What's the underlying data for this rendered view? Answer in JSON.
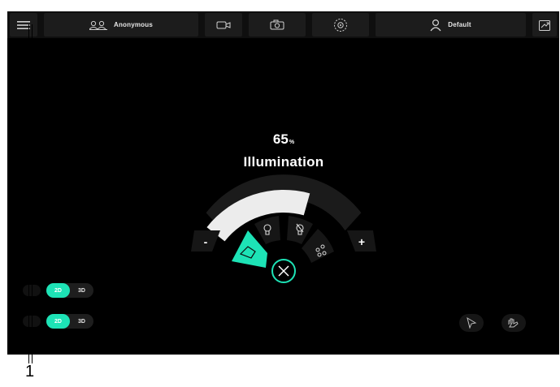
{
  "topbar": {
    "patient_label": "Anonymous",
    "profile_label": "Default",
    "icons": [
      "menu-icon",
      "patient-icon",
      "video-icon",
      "camera-icon",
      "focus-icon",
      "user-icon",
      "export-icon"
    ]
  },
  "illumination": {
    "value": "65",
    "unit": "%",
    "title": "Illumination",
    "level": 0.65,
    "minus_label": "-",
    "plus_label": "+",
    "modes": [
      "light-mode-icon",
      "bulb-icon",
      "bulb-alt-icon",
      "scene-icon"
    ],
    "close_icon": "close-icon"
  },
  "toggles": [
    {
      "on_label": "2D",
      "off_label": "3D"
    },
    {
      "on_label": "2D",
      "off_label": "3D"
    }
  ],
  "corner_buttons": [
    "pointer-icon",
    "hand-icon"
  ],
  "callout": {
    "number": "1"
  },
  "colors": {
    "accent": "#1de3b6",
    "background": "#000000",
    "bar": "#0f0f0f"
  }
}
